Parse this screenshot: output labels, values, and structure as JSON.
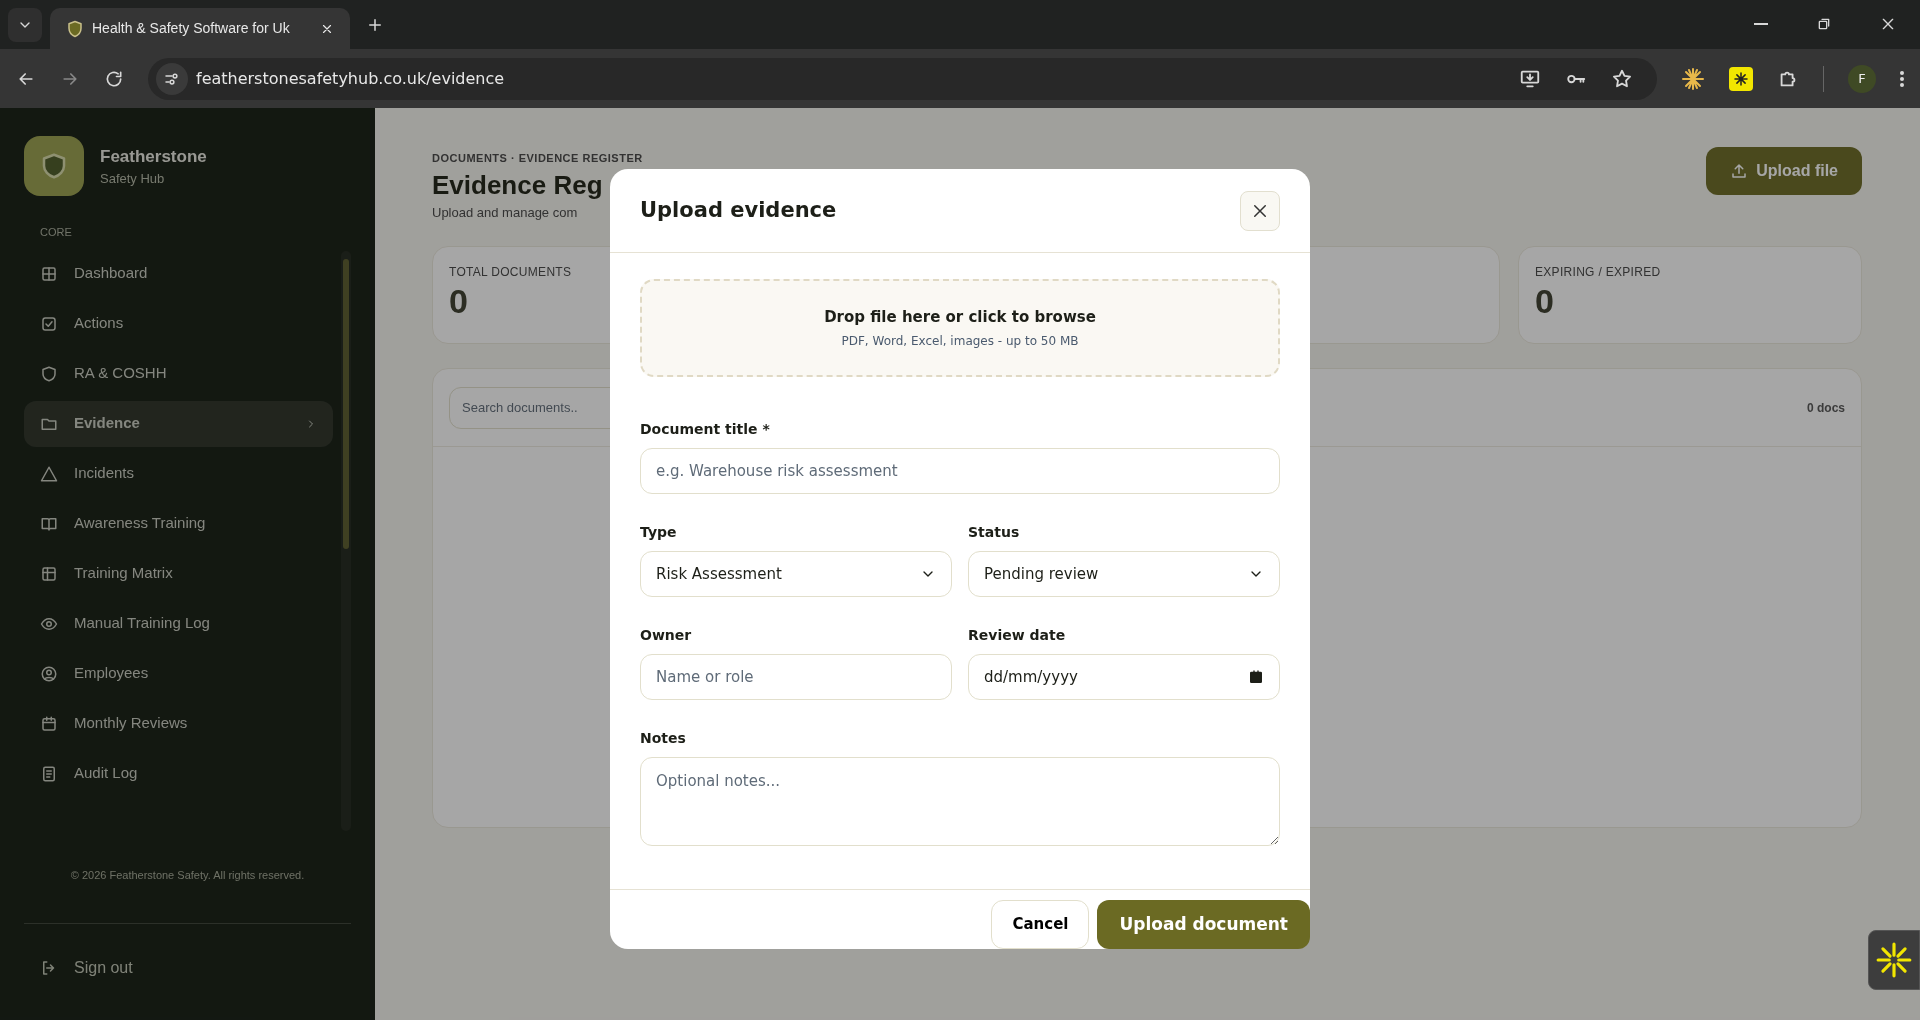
{
  "browser": {
    "tab_title": "Health & Safety Software for Uk",
    "url": "featherstonesafetyhub.co.uk/evidence",
    "profile_initial": "F"
  },
  "sidebar": {
    "brand_name": "Featherstone",
    "brand_sub": "Safety Hub",
    "section_label": "CORE",
    "items": [
      {
        "label": "Dashboard",
        "selected": false
      },
      {
        "label": "Actions",
        "selected": false
      },
      {
        "label": "RA & COSHH",
        "selected": false
      },
      {
        "label": "Evidence",
        "selected": true
      },
      {
        "label": "Incidents",
        "selected": false
      },
      {
        "label": "Awareness Training",
        "selected": false
      },
      {
        "label": "Training Matrix",
        "selected": false
      },
      {
        "label": "Manual Training Log",
        "selected": false
      },
      {
        "label": "Employees",
        "selected": false
      },
      {
        "label": "Monthly Reviews",
        "selected": false
      },
      {
        "label": "Audit Log",
        "selected": false
      }
    ],
    "footer_text": "© 2026 Featherstone Safety. All rights reserved.",
    "sign_out": "Sign out"
  },
  "page": {
    "breadcrumb": "DOCUMENTS · EVIDENCE REGISTER",
    "title": "Evidence Reg",
    "subtitle": "Upload and manage com",
    "upload_button": "Upload file",
    "stats": [
      {
        "label": "TOTAL DOCUMENTS",
        "value": "0"
      },
      {
        "label": "EXPIRING / EXPIRED",
        "value": "0"
      }
    ],
    "search_placeholder": "Search documents..",
    "doc_count": "0 docs"
  },
  "modal": {
    "title": "Upload evidence",
    "dropzone": {
      "title": "Drop file here or click to browse",
      "hint": "PDF, Word, Excel, images - up to 50 MB"
    },
    "rows": [
      [
        {
          "kind": "text",
          "label": "Document title *",
          "placeholder": "e.g. Warehouse risk assessment"
        }
      ],
      [
        {
          "kind": "select",
          "label": "Type",
          "value": "Risk Assessment"
        },
        {
          "kind": "select",
          "label": "Status",
          "value": "Pending review"
        }
      ],
      [
        {
          "kind": "text",
          "label": "Owner",
          "placeholder": "Name or role"
        },
        {
          "kind": "date",
          "label": "Review date",
          "placeholder": "dd/mm/yyyy"
        }
      ],
      [
        {
          "kind": "textarea",
          "label": "Notes",
          "placeholder": "Optional notes..."
        }
      ]
    ],
    "buttons": [
      {
        "label": "Cancel",
        "kind": "secondary"
      },
      {
        "label": "Upload document",
        "kind": "primary"
      }
    ]
  }
}
